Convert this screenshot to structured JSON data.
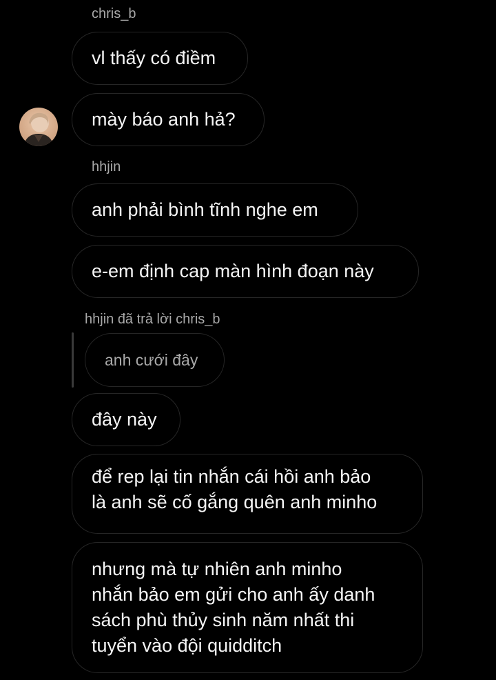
{
  "thread": {
    "messages": [
      {
        "sender": "chris_b",
        "text": "vl thấy có điềm"
      },
      {
        "text": "mày báo anh hả?"
      },
      {
        "sender": "hhjin",
        "text": "anh phải bình tĩnh nghe em"
      },
      {
        "text": "e-em định cap màn hình đoạn này"
      },
      {
        "reply_header": "hhjin đã trả lời chris_b",
        "quoted": "anh cưới đây",
        "text": "đây này"
      },
      {
        "text": "để rep lại tin nhắn cái hồi anh bảo\nlà anh sẽ cố gắng quên anh minho"
      },
      {
        "text": "nhưng mà tự nhiên anh minho\nnhắn bảo em gửi cho anh ấy danh\nsách phù thủy sinh năm nhất thi\ntuyển vào đội quidditch"
      }
    ]
  },
  "colors": {
    "background": "#000000",
    "bubble_border": "#262626",
    "sender_text": "#a8a8a8",
    "message_text": "#f5f5f5"
  },
  "icons": {
    "avatar": "profile-photo"
  }
}
